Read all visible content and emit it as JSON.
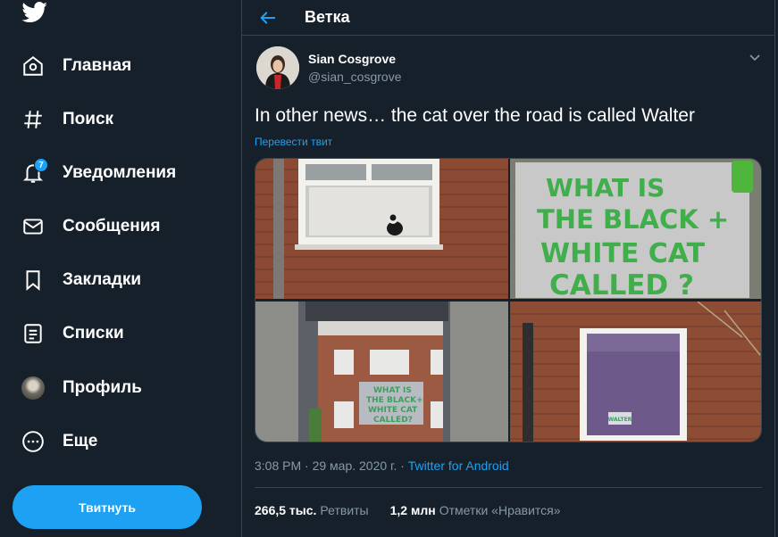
{
  "sidebar": {
    "items": [
      {
        "label": "Главная"
      },
      {
        "label": "Поиск"
      },
      {
        "label": "Уведомления",
        "badge": "7"
      },
      {
        "label": "Сообщения"
      },
      {
        "label": "Закладки"
      },
      {
        "label": "Списки"
      },
      {
        "label": "Профиль"
      },
      {
        "label": "Еще"
      }
    ],
    "tweet_button": "Твитнуть"
  },
  "header": {
    "title": "Ветка"
  },
  "tweet": {
    "author_name": "Sian Cosgrove",
    "author_handle": "@sian_cosgrove",
    "text": "In other news… the cat over the road is called Walter",
    "translate": "Перевести твит",
    "time": "3:08 PM · 29 мар. 2020 г. · ",
    "source": "Twitter for Android",
    "retweets_value": "266,5 тыс.",
    "retweets_label": "Ретвиты",
    "likes_value": "1,2 млн",
    "likes_label": "Отметки «Нравится»"
  },
  "media": {
    "sign_top_right": [
      "WHAT IS",
      "THE BLACK +",
      "WHITE CAT",
      "CALLED ?"
    ],
    "sign_bottom_left": [
      "WHAT IS",
      "THE BLACK+",
      "WHITE CAT",
      "CALLED?"
    ],
    "sign_bottom_right": "WALTER"
  },
  "colors": {
    "background": "#15202b",
    "accent": "#1da1f2",
    "secondary_text": "#8899a6",
    "border": "#38444d"
  }
}
